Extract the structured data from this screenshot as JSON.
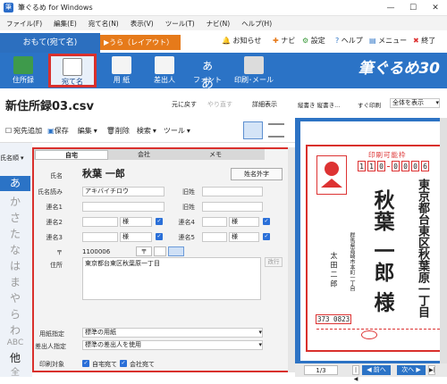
{
  "window": {
    "title": "筆ぐるめ for Windows"
  },
  "menu": [
    "ファイル(F)",
    "編集(E)",
    "宛て名(N)",
    "表示(V)",
    "ツール(T)",
    "ナビ(N)",
    "ヘルプ(H)"
  ],
  "tabs": {
    "omote": "おもて(宛て名)",
    "ura": "▶うら（レイアウト）へ切替"
  },
  "top_right": {
    "oshirase": "お知らせ",
    "navi": "ナビ",
    "settei": "設定",
    "help": "ヘルプ",
    "menu": "メニュー",
    "exit": "終了"
  },
  "ribbon": {
    "buttons": [
      "住所録",
      "宛て名",
      "用 紙",
      "差出人",
      "フォント",
      "印刷･メール"
    ],
    "brand": "筆ぐるめ30"
  },
  "doc": {
    "title": "新住所録03.csv",
    "undo": "元に戻す",
    "redo": "やり直す",
    "details": "詳細表示"
  },
  "toolbar": {
    "add": "宛先追加",
    "save": "保存",
    "edit": "編集",
    "delete": "削除",
    "search": "検索",
    "tool": "ツール"
  },
  "index": {
    "label": "氏名順",
    "kana": [
      "あ",
      "か",
      "さ",
      "た",
      "な",
      "は",
      "ま",
      "や",
      "ら",
      "わ",
      "ABC",
      "他",
      "全"
    ]
  },
  "form": {
    "tabs": [
      "自宅",
      "会社",
      "メモ"
    ],
    "name_label": "氏名",
    "name_value": "秋葉 一郎",
    "gaiji_button": "姓名外字",
    "yomi_label": "氏名読み",
    "yomi_value": "アキバイチロウ",
    "kyusei_label": "旧姓",
    "renmei_labels": [
      "連名1",
      "連名2",
      "連名3",
      "連名4",
      "連名5"
    ],
    "sama": "様",
    "zip_value": "1100006",
    "address_label": "住所",
    "address_value": "東京都台東区秋葉原一丁目",
    "gyo_button": "改行",
    "paper_label": "用紙指定",
    "paper_value": "標準の用紙",
    "sender_label": "差出人指定",
    "sender_value": "標準の差出人を使用",
    "print_label": "印刷対象",
    "print_home": "自宅宛て",
    "print_company": "会社宛て"
  },
  "preview": {
    "toolbar1": "縦書き 縦書き...",
    "toolbar2": "すぐ印刷",
    "select": "全体を表示",
    "printable": "印刷可能枠",
    "zip_digits": [
      "1",
      "1",
      "0",
      "0",
      "0",
      "0",
      "6"
    ],
    "address": "東京都台東区秋葉原一丁目",
    "name": "秋葉 一郎 様",
    "sender_address": "群馬県高崎市本町一丁目",
    "sender_name": "太 田 二 郎",
    "sender_zip": "373 0823",
    "page": "1/3",
    "prev": "◀ 前へ",
    "next": "次へ ▶"
  },
  "colors": {
    "ribbon": "#2b73c6",
    "ura_tab": "#e67a1a",
    "highlight": "#d9302c"
  }
}
